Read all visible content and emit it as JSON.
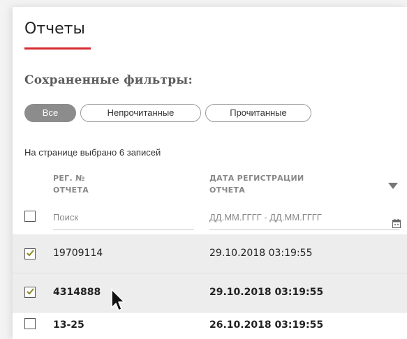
{
  "page": {
    "title": "Отчеты",
    "saved_filters_label": "Сохраненные фильтры:",
    "accent_color": "#d62b31"
  },
  "filters": [
    {
      "label": "Все",
      "active": true
    },
    {
      "label": "Непрочитанные",
      "active": false
    },
    {
      "label": "Прочитанные",
      "active": false
    }
  ],
  "selection_info": "На странице выбрано 6 записей",
  "table": {
    "columns": [
      {
        "line1": "РЕГ. №",
        "line2": "ОТЧЕТА"
      },
      {
        "line1": "ДАТА РЕГИСТРАЦИИ",
        "line2": "ОТЧЕТА"
      }
    ],
    "search_placeholder": "Поиск",
    "date_placeholder": "ДД.ММ.ГГГГ - ДД.ММ.ГГГГ",
    "rows": [
      {
        "number": "19709114",
        "date": "29.10.2018 03:19:55",
        "checked": true,
        "bold": false
      },
      {
        "number": "4314888",
        "date": "29.10.2018 03:19:55",
        "checked": true,
        "bold": true
      },
      {
        "number": "13-25",
        "date": "26.10.2018 03:19:55",
        "checked": false,
        "bold": true
      }
    ]
  },
  "icons": {
    "sort": "chevron-down-icon",
    "calendar": "calendar-icon",
    "cursor": "mouse-pointer-icon",
    "check": "checkmark-icon"
  }
}
